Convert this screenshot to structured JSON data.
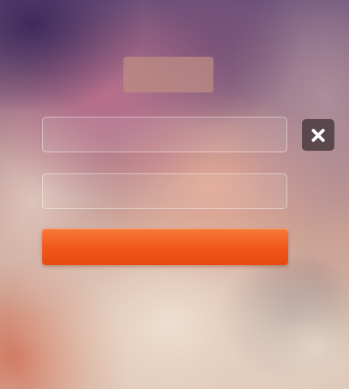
{
  "title": {
    "text": ""
  },
  "form": {
    "field1": {
      "value": "",
      "placeholder": ""
    },
    "field2": {
      "value": "",
      "placeholder": ""
    },
    "close": {
      "icon": "close-icon"
    },
    "submit": {
      "label": ""
    }
  },
  "colors": {
    "accent": "#f0561a",
    "close_bg": "#4b3c41"
  }
}
